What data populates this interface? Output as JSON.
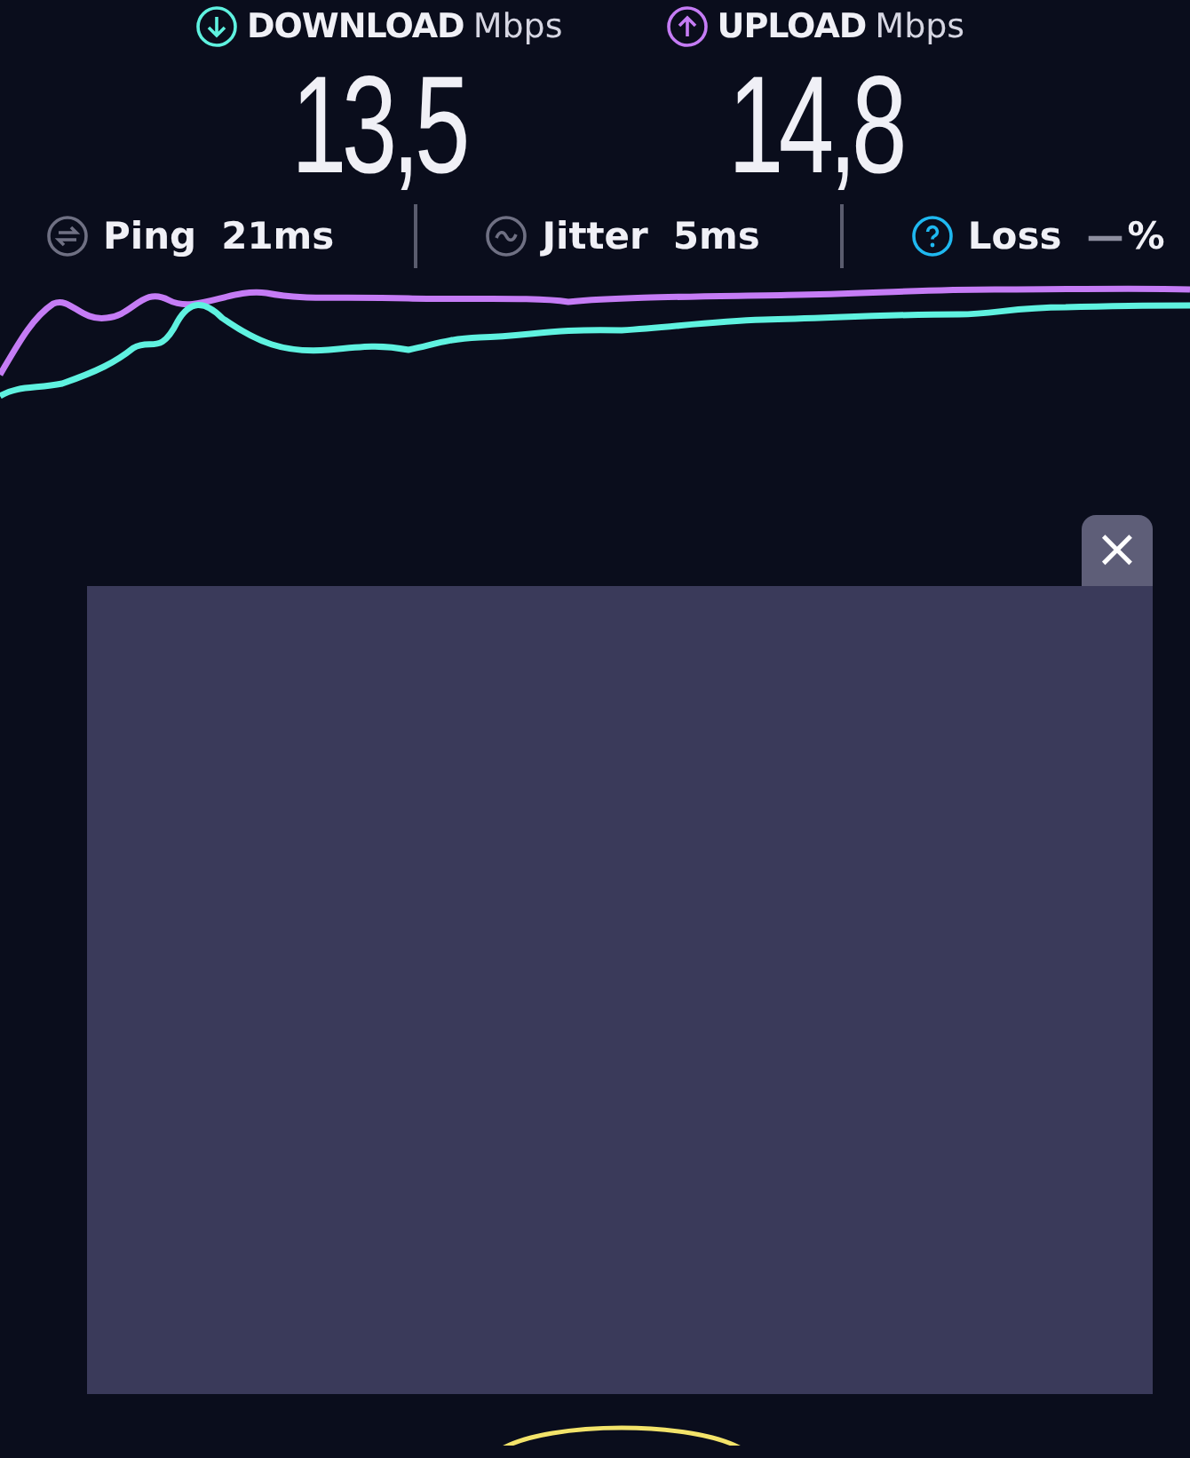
{
  "speeds": [
    {
      "kind": "download",
      "label": "DOWNLOAD",
      "unit": "Mbps",
      "value": "13,5"
    },
    {
      "kind": "upload",
      "label": "UPLOAD",
      "unit": "Mbps",
      "value": "14,8"
    }
  ],
  "metrics": [
    {
      "kind": "ping",
      "label": "Ping",
      "value": "21ms"
    },
    {
      "kind": "jitter",
      "label": "Jitter",
      "value": "5ms"
    },
    {
      "kind": "loss",
      "label": "Loss",
      "value": "—",
      "unit": "%"
    }
  ],
  "ad": {
    "close": "×"
  }
}
